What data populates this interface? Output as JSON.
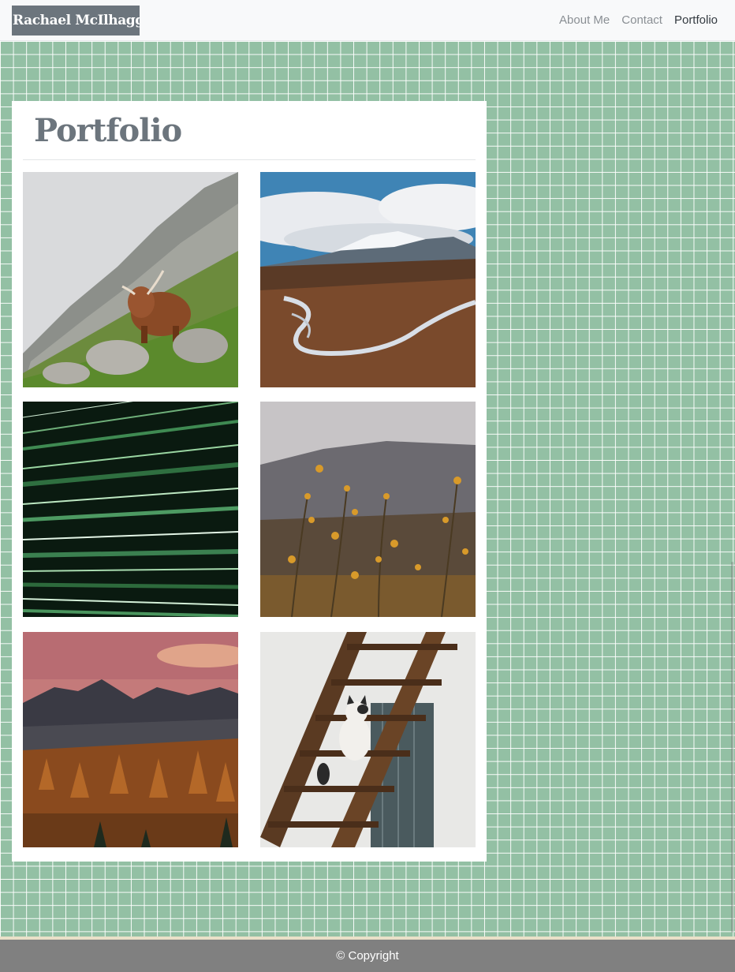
{
  "navbar": {
    "brand": "Rachael McIlhagga",
    "links": [
      {
        "label": "About Me",
        "active": false
      },
      {
        "label": "Contact",
        "active": false
      },
      {
        "label": "Portfolio",
        "active": true
      }
    ]
  },
  "portfolio": {
    "title": "Portfolio",
    "photos": [
      {
        "subject": "highland cow on rocky hillside"
      },
      {
        "subject": "mountain valley with winding river"
      },
      {
        "subject": "green light streaks abstract"
      },
      {
        "subject": "yellow wildflowers in misty field"
      },
      {
        "subject": "autumn forest beneath mountain peaks at sunset"
      },
      {
        "subject": "cat on wooden staircase"
      }
    ]
  },
  "footer": {
    "text": "© Copyright"
  },
  "colors": {
    "background": "#93c0a4",
    "navbar": "#f8f9fa",
    "brand_bg": "#6c757d",
    "footer": "#808080"
  }
}
